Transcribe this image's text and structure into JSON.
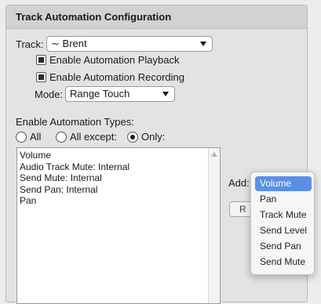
{
  "panel": {
    "title": "Track Automation Configuration"
  },
  "track": {
    "label": "Track:",
    "value": "Brent",
    "icon": "waveform-tilde-icon"
  },
  "options": {
    "playback_label": "Enable Automation Playback",
    "playback_checked": true,
    "recording_label": "Enable Automation Recording",
    "recording_checked": true
  },
  "mode": {
    "label": "Mode:",
    "value": "Range Touch"
  },
  "types": {
    "heading": "Enable Automation Types:",
    "radios": [
      {
        "label": "All",
        "selected": false
      },
      {
        "label": "All except:",
        "selected": false
      },
      {
        "label": "Only:",
        "selected": true
      }
    ],
    "list": [
      "Volume",
      "Audio Track Mute: Internal",
      "Send Mute: Internal",
      "Send Pan: Internal",
      "Pan"
    ]
  },
  "add": {
    "label": "Add:",
    "button_partial": "R",
    "menu": [
      {
        "label": "Volume",
        "selected": true
      },
      {
        "label": "Pan",
        "selected": false
      },
      {
        "label": "Track Mute",
        "selected": false
      },
      {
        "label": "Send Level",
        "selected": false
      },
      {
        "label": "Send Pan",
        "selected": false
      },
      {
        "label": "Send Mute",
        "selected": false
      }
    ]
  },
  "colors": {
    "menu_highlight": "#5b8fe6",
    "panel_bg": "#e3e3e3",
    "header_bg": "#d2d2d2"
  }
}
